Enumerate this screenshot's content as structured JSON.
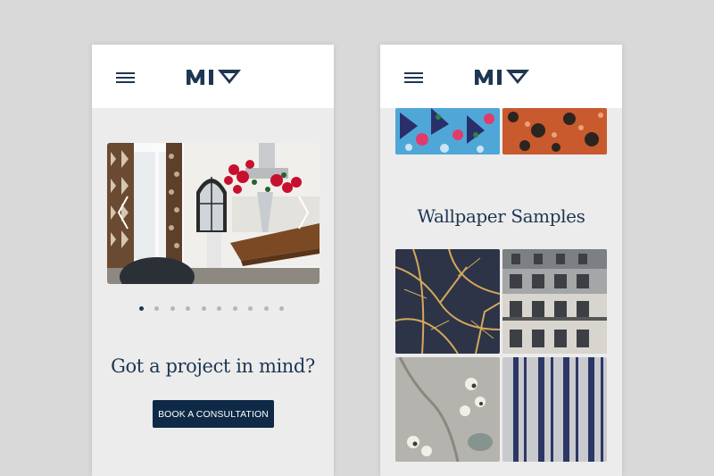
{
  "brand": {
    "logo_text": "MIV",
    "navy": "#1d3752",
    "button_color": "#0e2a47"
  },
  "left_screen": {
    "menu_icon": "hamburger-menu-icon",
    "carousel": {
      "slide_count": 10,
      "active_slide": 1,
      "prev_icon": "chevron-left-icon",
      "next_icon": "chevron-right-icon"
    },
    "cta": {
      "heading": "Got a project in mind?",
      "button_label": "BOOK A CONSULTATION"
    }
  },
  "right_screen": {
    "menu_icon": "hamburger-menu-icon",
    "section_title": "Wallpaper Samples"
  }
}
